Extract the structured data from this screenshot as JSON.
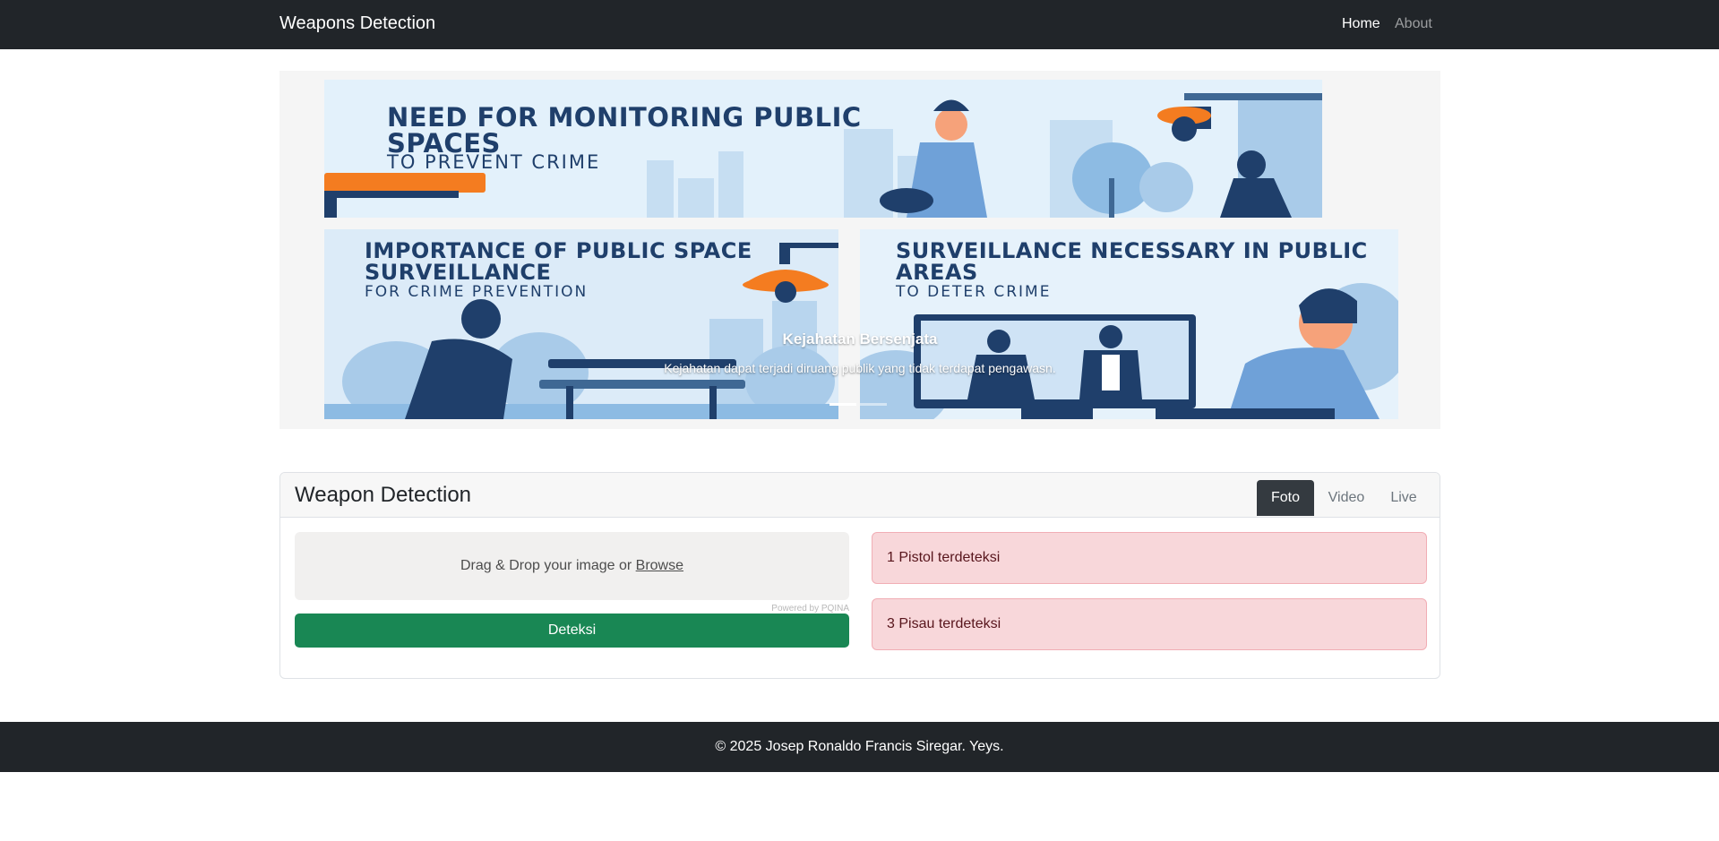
{
  "navbar": {
    "brand": "Weapons Detection",
    "links": [
      {
        "label": "Home",
        "active": true
      },
      {
        "label": "About",
        "active": false
      }
    ]
  },
  "carousel": {
    "posters": [
      {
        "headline": "NEED FOR MONITORING PUBLIC SPACES",
        "subline": "TO PREVENT CRIME"
      },
      {
        "headline": "IMPORTANCE OF PUBLIC SPACE SURVEILLANCE",
        "subline": "FOR CRIME PREVENTION"
      },
      {
        "headline": "SURVEILLANCE NECESSARY IN PUBLIC AREAS",
        "subline": "TO DETER CRIME"
      }
    ],
    "caption": {
      "title": "Kejahatan Bersenjata",
      "text": "Kejahatan dapat terjadi diruang publik yang tidak terdapat pengawasn."
    },
    "slide_count": 2,
    "active_slide": 1
  },
  "detection_card": {
    "title": "Weapon Detection",
    "tabs": [
      {
        "label": "Foto",
        "active": true
      },
      {
        "label": "Video",
        "active": false
      },
      {
        "label": "Live",
        "active": false
      }
    ],
    "dropzone": {
      "text": "Drag & Drop your image or",
      "browse_label": "Browse",
      "powered_by": "Powered by PQINA"
    },
    "detect_button": "Deteksi",
    "results": [
      {
        "text": "1 Pistol terdeteksi"
      },
      {
        "text": "3 Pisau terdeteksi"
      }
    ]
  },
  "footer": {
    "text": "© 2025 Josep Ronaldo Francis Siregar. Yeys."
  },
  "colors": {
    "navbar_bg": "#212529",
    "button_success": "#198754",
    "alert_bg": "#f8d7da",
    "tab_active_bg": "#343a40",
    "poster_navy": "#1f3f6b",
    "poster_orange": "#f47c20"
  }
}
